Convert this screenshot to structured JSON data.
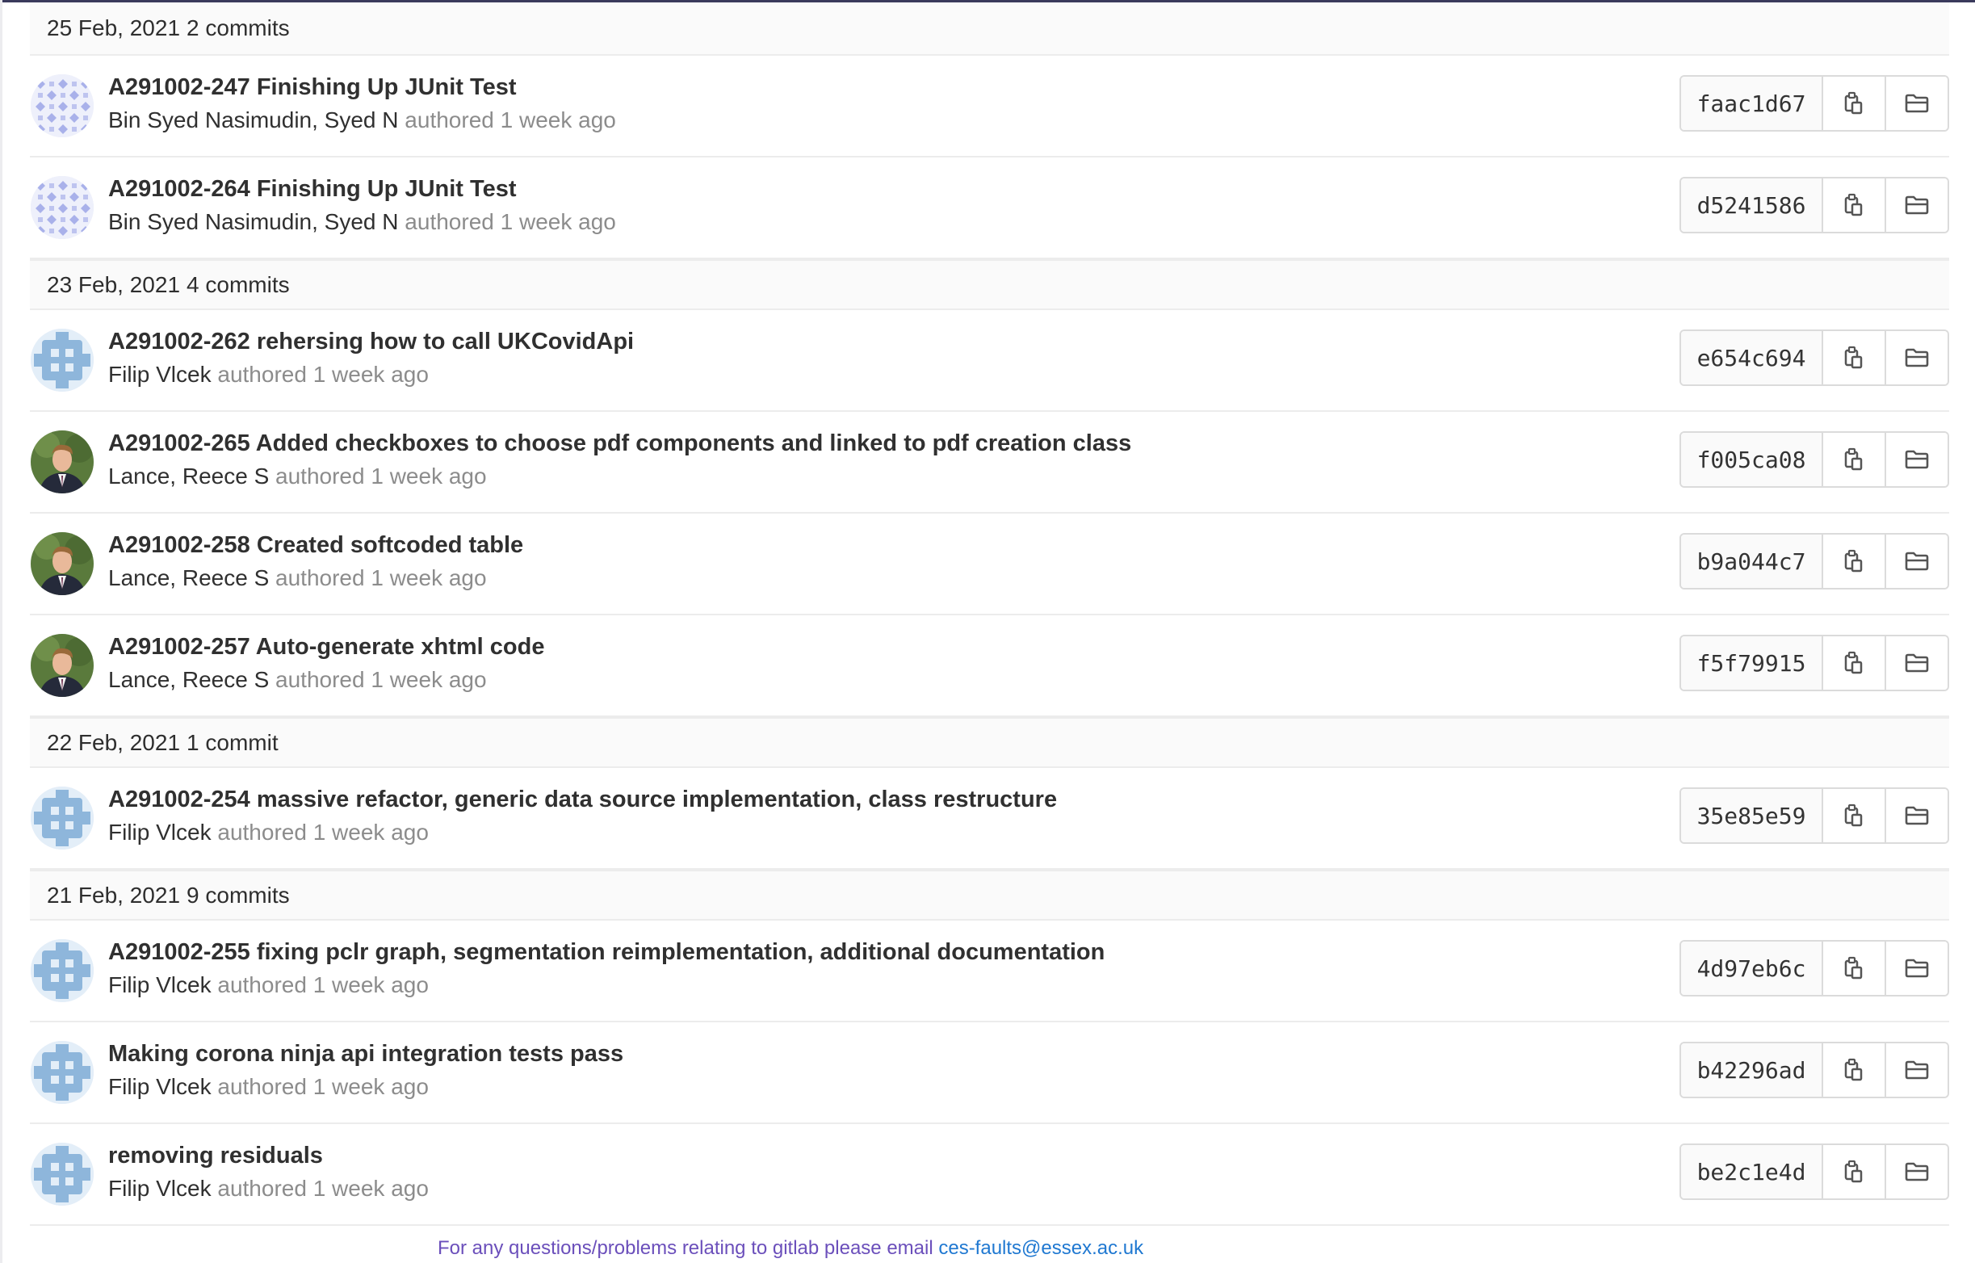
{
  "footer": {
    "text": "For any questions/problems relating to gitlab please email",
    "email": "ces-faults@essex.ac.uk"
  },
  "colors": {
    "link": "#1f78d1",
    "footer_text": "#6b4fbb",
    "muted": "#8c8c8c"
  },
  "groups": [
    {
      "date": "25 Feb, 2021",
      "count": "2 commits",
      "commits": [
        {
          "message": "A291002-247 Finishing Up JUnit Test",
          "author": "Bin Syed Nasimudin, Syed N",
          "verb": "authored",
          "time": "1 week ago",
          "sha": "faac1d67",
          "avatar": "identicon-purple"
        },
        {
          "message": "A291002-264 Finishing Up JUnit Test",
          "author": "Bin Syed Nasimudin, Syed N",
          "verb": "authored",
          "time": "1 week ago",
          "sha": "d5241586",
          "avatar": "identicon-purple"
        }
      ]
    },
    {
      "date": "23 Feb, 2021",
      "count": "4 commits",
      "commits": [
        {
          "message": "A291002-262 rehersing how to call UKCovidApi",
          "author": "Filip Vlcek",
          "verb": "authored",
          "time": "1 week ago",
          "sha": "e654c694",
          "avatar": "identicon-blue"
        },
        {
          "message": "A291002-265 Added checkboxes to choose pdf components and linked to pdf creation class",
          "author": "Lance, Reece S",
          "verb": "authored",
          "time": "1 week ago",
          "sha": "f005ca08",
          "avatar": "photo-person"
        },
        {
          "message": "A291002-258 Created softcoded table",
          "author": "Lance, Reece S",
          "verb": "authored",
          "time": "1 week ago",
          "sha": "b9a044c7",
          "avatar": "photo-person"
        },
        {
          "message": "A291002-257 Auto-generate xhtml code",
          "author": "Lance, Reece S",
          "verb": "authored",
          "time": "1 week ago",
          "sha": "f5f79915",
          "avatar": "photo-person"
        }
      ]
    },
    {
      "date": "22 Feb, 2021",
      "count": "1 commit",
      "commits": [
        {
          "message": "A291002-254 massive refactor, generic data source implementation, class restructure",
          "author": "Filip Vlcek",
          "verb": "authored",
          "time": "1 week ago",
          "sha": "35e85e59",
          "avatar": "identicon-blue"
        }
      ]
    },
    {
      "date": "21 Feb, 2021",
      "count": "9 commits",
      "commits": [
        {
          "message": "A291002-255 fixing pclr graph, segmentation reimplementation, additional documentation",
          "author": "Filip Vlcek",
          "verb": "authored",
          "time": "1 week ago",
          "sha": "4d97eb6c",
          "avatar": "identicon-blue"
        },
        {
          "message": "Making corona ninja api integration tests pass",
          "author": "Filip Vlcek",
          "verb": "authored",
          "time": "1 week ago",
          "sha": "b42296ad",
          "avatar": "identicon-blue"
        },
        {
          "message": "removing residuals",
          "author": "Filip Vlcek",
          "verb": "authored",
          "time": "1 week ago",
          "sha": "be2c1e4d",
          "avatar": "identicon-blue"
        }
      ]
    }
  ]
}
